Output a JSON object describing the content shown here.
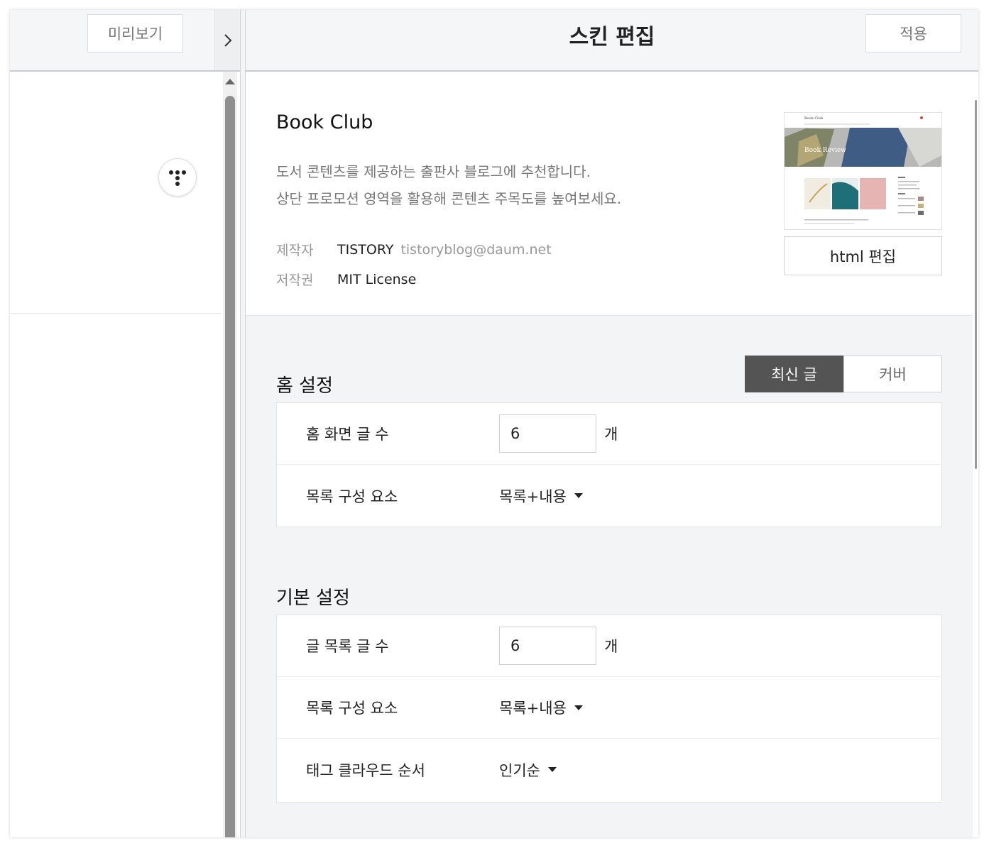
{
  "left_panel": {
    "preview_label": "미리보기",
    "expand_icon": "chevron-right-icon",
    "logo_icon": "tistory-logo-icon"
  },
  "header": {
    "title": "스킨 편집",
    "apply_label": "적용"
  },
  "skin": {
    "name": "Book Club",
    "description_lines": [
      "도서 콘텐츠를 제공하는 출판사 블로그에 추천합니다.",
      "상단 프로모션 영역을 활용해 콘텐츠 주목도를 높여보세요."
    ],
    "author_label": "제작자",
    "author": "TISTORY",
    "author_email": "tistoryblog@daum.net",
    "license_label": "저작권",
    "license": "MIT License",
    "thumbnail": {
      "site_title": "Book Club",
      "banner_text": "Book Review"
    },
    "html_edit_label": "html 편집"
  },
  "home_settings": {
    "title": "홈 설정",
    "toggle": {
      "options": [
        "최신 글",
        "커버"
      ],
      "selected": "최신 글"
    },
    "rows": {
      "post_count_label": "홈 화면 글 수",
      "post_count_value": "6",
      "post_count_unit": "개",
      "list_element_label": "목록 구성 요소",
      "list_element_value": "목록+내용"
    }
  },
  "basic_settings": {
    "title": "기본 설정",
    "rows": {
      "post_count_label": "글 목록 글 수",
      "post_count_value": "6",
      "post_count_unit": "개",
      "list_element_label": "목록 구성 요소",
      "list_element_value": "목록+내용",
      "tag_order_label": "태그 클라우드 순서",
      "tag_order_value": "인기순"
    }
  }
}
